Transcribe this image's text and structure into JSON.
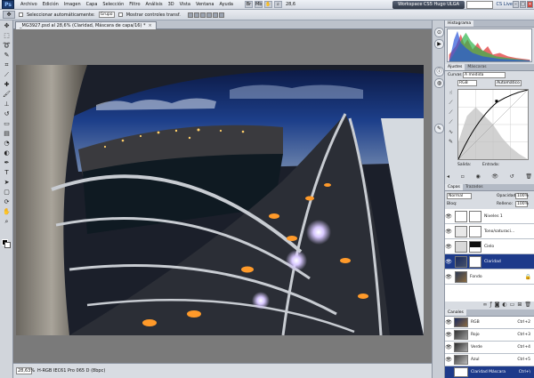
{
  "app": {
    "logo": "Ps",
    "menus": [
      "Archivo",
      "Edición",
      "Imagen",
      "Capa",
      "Selección",
      "Filtro",
      "Análisis",
      "3D",
      "Vista",
      "Ventana",
      "Ayuda"
    ],
    "zoom": "28,6",
    "workspace": "Workspace CS5 Hugo ULGA",
    "cs_live": "CS Live"
  },
  "options": {
    "auto_select": "Seleccionar automáticamente:",
    "group": "Grupo",
    "transform": "Mostrar controles transf."
  },
  "document": {
    "tab_title": "_MG3927.psd al 28,6% (Claridad, Máscara de capa/16) *",
    "close": "×"
  },
  "status": {
    "zoom": "28,63%",
    "info": "H-RGB IEC61 Pro 065 D (8bpc)"
  },
  "panels": {
    "histogram_tab": "Histograma",
    "adjust_tabs": [
      "Ajustes",
      "Máscaras"
    ],
    "curves_label": "Curvas",
    "preset": "A medida",
    "channel": "RGB",
    "auto": "Automático",
    "output": "Salida:",
    "input": "Entrada:",
    "layer_tabs": [
      "Capas",
      "Trazados"
    ],
    "blend_mode": "Normal",
    "opacity_label": "Opacidad:",
    "opacity": "100%",
    "lock_label": "Bloq:",
    "fill_label": "Relleno:",
    "fill": "100%",
    "channels_tab": "Canales"
  },
  "layers": [
    {
      "name": "Niveles 1",
      "selected": false,
      "thumb": "#ffffff",
      "mask": "#ffffff",
      "lock": ""
    },
    {
      "name": "Tono/saturaci...",
      "selected": false,
      "thumb": "#e8e8e8",
      "mask": "#ffffff",
      "lock": ""
    },
    {
      "name": "Cielo",
      "selected": false,
      "thumb": "#d9d9d9",
      "mask": "#111111",
      "lock": ""
    },
    {
      "name": "Claridad",
      "selected": true,
      "thumb": "#1a2a5e",
      "mask": "#ffffff",
      "lock": ""
    },
    {
      "name": "Fondo",
      "selected": false,
      "thumb": "#2b3a55",
      "mask": "",
      "lock": "🔒"
    }
  ],
  "channels": [
    {
      "name": "RGB",
      "shortcut": "Ctrl+2",
      "selected": false
    },
    {
      "name": "Rojo",
      "shortcut": "Ctrl+3",
      "selected": false
    },
    {
      "name": "Verde",
      "shortcut": "Ctrl+4",
      "selected": false
    },
    {
      "name": "Azul",
      "shortcut": "Ctrl+5",
      "selected": false
    },
    {
      "name": "Claridad Máscara",
      "shortcut": "Ctrl+\\",
      "selected": true
    }
  ],
  "colors": {
    "selection": "#1d3a8a",
    "sky": "#1d3f8a",
    "bridge": "#c8ccd2",
    "light": "#ff9a2a"
  }
}
